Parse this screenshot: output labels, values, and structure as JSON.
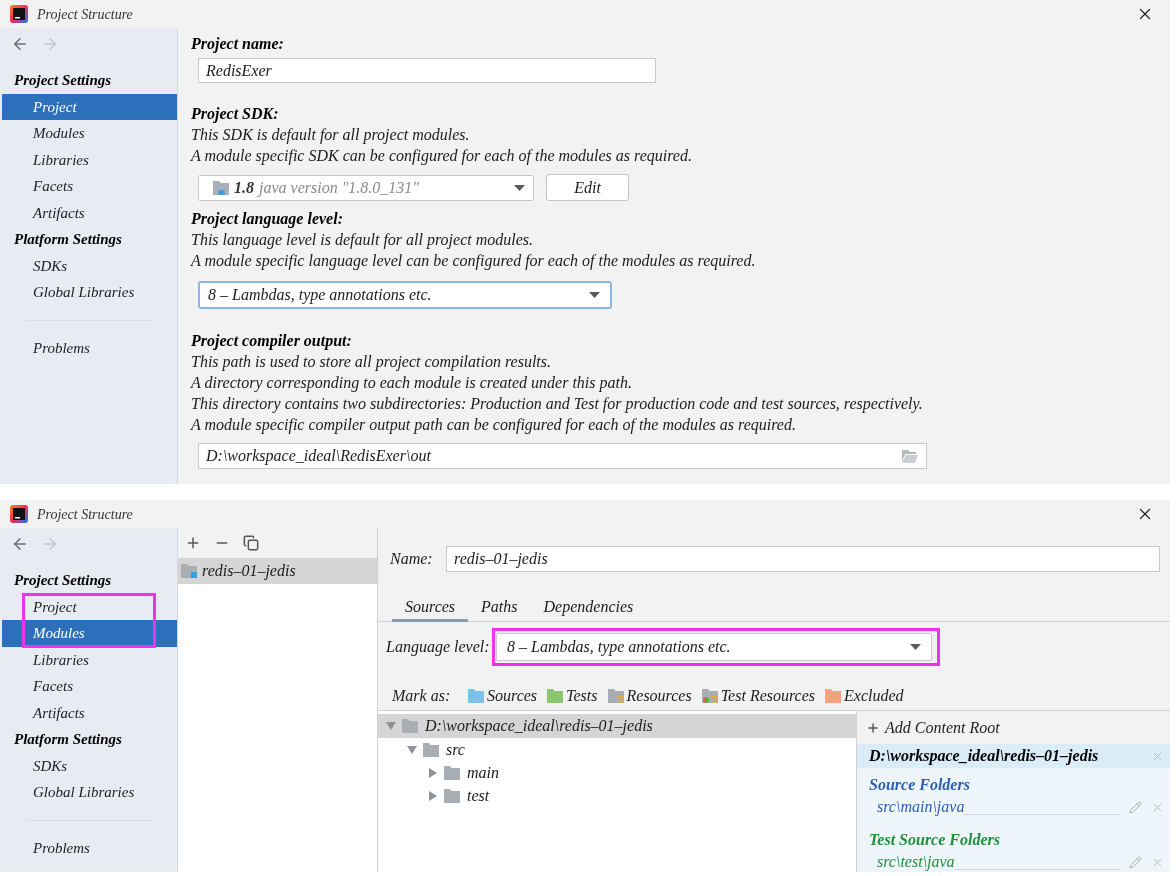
{
  "dialogs": [
    {
      "kind": "project",
      "title": "Project Structure",
      "navigation": {
        "back_enabled": true,
        "forward_enabled": false
      },
      "sidebar": {
        "sections": [
          {
            "heading": "Project Settings",
            "items": [
              {
                "label": "Project",
                "selected": true
              },
              {
                "label": "Modules",
                "selected": false
              },
              {
                "label": "Libraries",
                "selected": false
              },
              {
                "label": "Facets",
                "selected": false
              },
              {
                "label": "Artifacts",
                "selected": false
              }
            ]
          },
          {
            "heading": "Platform Settings",
            "items": [
              {
                "label": "SDKs",
                "selected": false
              },
              {
                "label": "Global Libraries",
                "selected": false
              }
            ]
          }
        ],
        "footer_items": [
          {
            "label": "Problems",
            "selected": false
          }
        ]
      },
      "project_name": {
        "label": "Project name:",
        "value": "RedisExer"
      },
      "project_sdk": {
        "label": "Project SDK:",
        "description": [
          "This SDK is default for all project modules.",
          "A module specific SDK can be configured for each of the modules as required."
        ],
        "sdk_version": "1.8",
        "sdk_detail": "java version \"1.8.0_131\"",
        "edit_button": "Edit"
      },
      "language_level": {
        "label": "Project language level:",
        "description": [
          "This language level is default for all project modules.",
          "A module specific language level can be configured for each of the modules as required."
        ],
        "value": "8 – Lambdas, type annotations etc.",
        "focused": true
      },
      "compiler_output": {
        "label": "Project compiler output:",
        "description": [
          "This path is used to store all project compilation results.",
          "A directory corresponding to each module is created under this path.",
          "This directory contains two subdirectories: Production and Test for production code and test sources, respectively.",
          "A module specific compiler output path can be configured for each of the modules as required."
        ],
        "value": "D:\\workspace_ideal\\RedisExer\\out"
      }
    },
    {
      "kind": "modules",
      "title": "Project Structure",
      "navigation": {
        "back_enabled": true,
        "forward_enabled": false
      },
      "sidebar": {
        "sections": [
          {
            "heading": "Project Settings",
            "items": [
              {
                "label": "Project",
                "selected": false,
                "highlighted": true
              },
              {
                "label": "Modules",
                "selected": true,
                "highlighted": true
              },
              {
                "label": "Libraries",
                "selected": false,
                "highlighted": false
              },
              {
                "label": "Facets",
                "selected": false,
                "highlighted": false
              },
              {
                "label": "Artifacts",
                "selected": false,
                "highlighted": false
              }
            ]
          },
          {
            "heading": "Platform Settings",
            "items": [
              {
                "label": "SDKs",
                "selected": false,
                "highlighted": false
              },
              {
                "label": "Global Libraries",
                "selected": false,
                "highlighted": false
              }
            ]
          }
        ],
        "footer_items": [
          {
            "label": "Problems",
            "selected": false,
            "highlighted": false
          }
        ]
      },
      "modules": [
        {
          "name": "redis–01–jedis",
          "selected": true
        }
      ],
      "name_field": {
        "label": "Name:",
        "value": "redis–01–jedis"
      },
      "tabs": [
        {
          "label": "Sources",
          "selected": true
        },
        {
          "label": "Paths",
          "selected": false
        },
        {
          "label": "Dependencies",
          "selected": false
        }
      ],
      "language_level": {
        "label": "Language level:",
        "value": "8 – Lambdas, type annotations etc.",
        "highlighted": true
      },
      "mark_as": {
        "label": "Mark as:",
        "options": [
          {
            "kind": "sources",
            "label": "Sources"
          },
          {
            "kind": "tests",
            "label": "Tests"
          },
          {
            "kind": "resources",
            "label": "Resources"
          },
          {
            "kind": "test_resources",
            "label": "Test Resources"
          },
          {
            "kind": "excluded",
            "label": "Excluded"
          }
        ]
      },
      "tree": [
        {
          "label": "D:\\workspace_ideal\\redis–01–jedis",
          "selected": true,
          "expanded": true,
          "children": [
            {
              "label": "src",
              "selected": false,
              "expanded": true,
              "children": [
                {
                  "label": "main",
                  "selected": false,
                  "expanded": false
                },
                {
                  "label": "test",
                  "selected": false,
                  "expanded": false
                }
              ]
            }
          ]
        }
      ],
      "content_root": {
        "add_button": "Add Content Root",
        "path": "D:\\workspace_ideal\\redis–01–jedis",
        "folder_groups": [
          {
            "kind": "source",
            "heading": "Source Folders",
            "paths": [
              "src\\main\\java"
            ]
          },
          {
            "kind": "test",
            "heading": "Test Source Folders",
            "paths": [
              "src\\test\\java"
            ]
          }
        ]
      }
    }
  ]
}
